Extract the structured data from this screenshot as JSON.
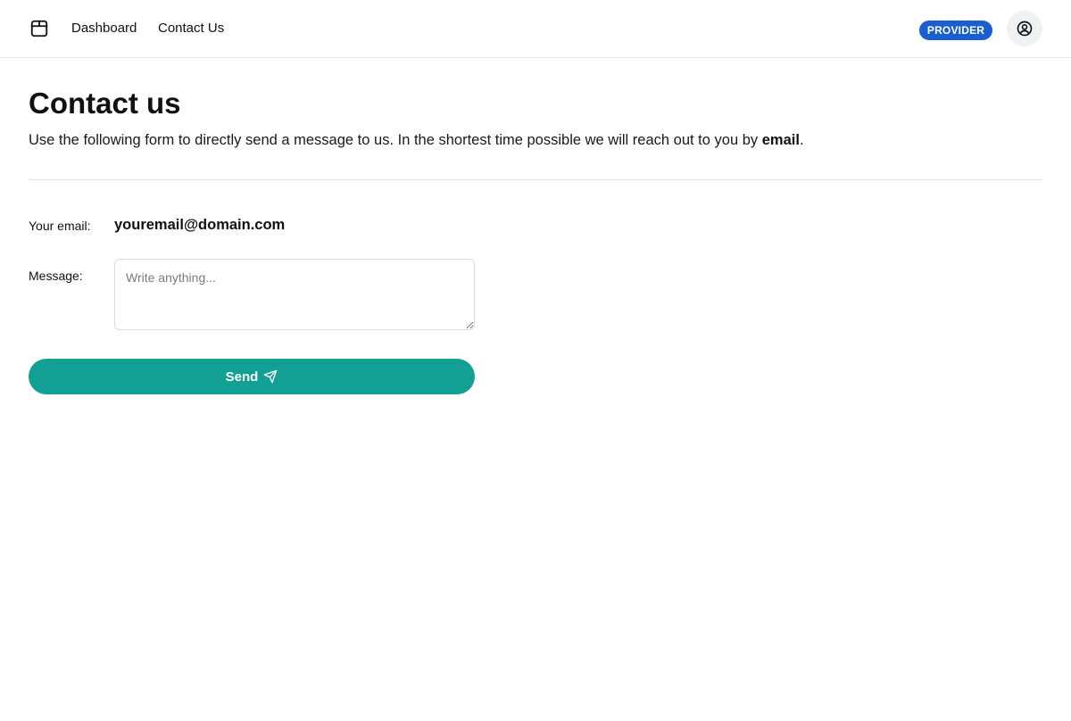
{
  "nav": {
    "logo_icon": "package-box-icon",
    "links": [
      {
        "label": "Dashboard"
      },
      {
        "label": "Contact Us"
      }
    ],
    "role_badge": "PROVIDER",
    "role_badge_color": "#1a5fd0",
    "user_icon": "user-circle-icon"
  },
  "page": {
    "title": "Contact us",
    "description_prefix": "Use the following form to directly send a message to us. In the shortest time possible we will reach out to you by ",
    "description_emphasis": "email",
    "description_suffix": "."
  },
  "form": {
    "email_label": "Your email:",
    "email_value": "youremail@domain.com",
    "message_label": "Message:",
    "message_placeholder": "Write anything...",
    "message_value": "",
    "send_label": "Send",
    "send_icon": "send-paper-plane-icon",
    "send_color": "#13a094"
  }
}
